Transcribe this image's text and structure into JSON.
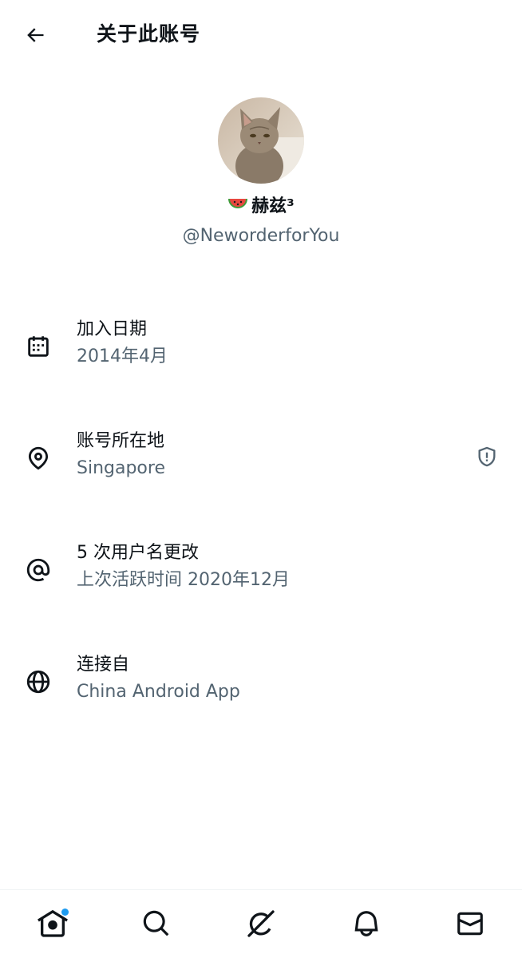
{
  "header": {
    "title": "关于此账号",
    "back_icon": "arrow-left-icon"
  },
  "profile": {
    "display_name": "赫兹³",
    "name_emoji": "watermelon-icon",
    "handle": "@NeworderforYou",
    "avatar": "cat-photo-avatar"
  },
  "rows": [
    {
      "icon": "calendar-icon",
      "label": "加入日期",
      "value": "2014年4月"
    },
    {
      "icon": "location-pin-icon",
      "label": "账号所在地",
      "value": "Singapore",
      "trailing_icon": "shield-alert-icon"
    },
    {
      "icon": "at-sign-icon",
      "label": "5 次用户名更改",
      "value": "上次活跃时间 2020年12月"
    },
    {
      "icon": "globe-icon",
      "label": "连接自",
      "value": "China Android App"
    }
  ],
  "bottom_nav": {
    "items": [
      "home-icon",
      "search-icon",
      "grok-icon",
      "notifications-icon",
      "messages-icon"
    ],
    "home_has_notification_dot": true
  },
  "colors": {
    "text_primary": "#0f1419",
    "text_secondary": "#536471",
    "accent": "#1d9bf0",
    "divider": "#eff3f4"
  }
}
